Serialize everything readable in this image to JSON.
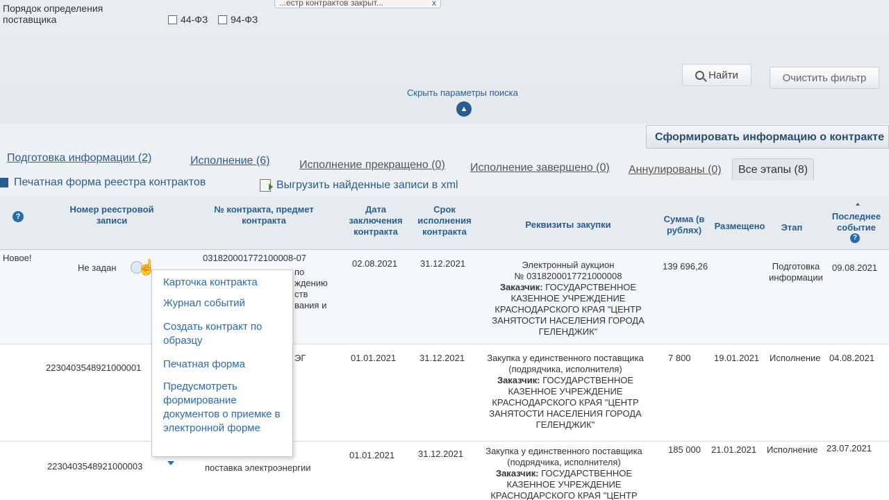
{
  "browser_tab": {
    "title": "...естр контрактов закрыт...",
    "close": "x"
  },
  "search": {
    "order_label": "Порядок определения поставщика",
    "law_options": [
      "44-ФЗ",
      "94-ФЗ"
    ],
    "find_button": "Найти",
    "clear_button": "Очистить фильтр",
    "hide_params": "Скрыть параметры поиска"
  },
  "generate_button": "Сформировать информацию о контракте",
  "tabs": [
    {
      "label": "Подготовка информации (2)"
    },
    {
      "label": "Исполнение (6)"
    },
    {
      "label": "Исполнение прекращено (0)"
    },
    {
      "label": "Исполнение завершено (0)"
    },
    {
      "label": "Аннулированы (0)"
    },
    {
      "label": "Все этапы (8)"
    }
  ],
  "toolbar": {
    "print_registry": "Печатная форма реестра контрактов",
    "export_xml": "Выгрузить найденные записи в xml"
  },
  "table": {
    "headers": {
      "registry_number": "Номер реестровой записи",
      "contract_number": "№ контракта, предмет контракта",
      "conclusion_date": "Дата заключения контракта",
      "execution_term": "Срок исполнения контракта",
      "procurement_details": "Реквизиты закупки",
      "amount": "Сумма (в рублях)",
      "placed": "Размещено",
      "stage": "Этап",
      "last_event": "Последнее событие"
    },
    "rows": [
      {
        "flag": "Новое!",
        "registry_number": "Не задан",
        "contract_number": "031820001772100008-07",
        "subject_fragments": [
          "по",
          "ждению",
          "ств",
          "вания и"
        ],
        "conclusion_date": "02.08.2021",
        "execution_term": "31.12.2021",
        "procurement_type": "Электронный аукцион",
        "procurement_number": "№ 0318200017721000008",
        "customer_label": "Заказчик:",
        "customer_name": "ГОСУДАРСТВЕННОЕ КАЗЕННОЕ УЧРЕЖДЕНИЕ КРАСНОДАРСКОГО КРАЯ \"ЦЕНТР ЗАНЯТОСТИ НАСЕЛЕНИЯ ГОРОДА ГЕЛЕНДЖИК\"",
        "amount": "139 696,26",
        "placed": "",
        "stage": "Подготовка информации",
        "last_event": "09.08.2021"
      },
      {
        "flag": "",
        "registry_number": "2230403548921000001",
        "subject_fragment": "ЭГ",
        "conclusion_date": "01.01.2021",
        "execution_term": "31.12.2021",
        "procurement_type": "Закупка у единственного поставщика (подрядчика, исполнителя)",
        "customer_label": "Заказчик:",
        "customer_name": "ГОСУДАРСТВЕННОЕ КАЗЕННОЕ УЧРЕЖДЕНИЕ КРАСНОДАРСКОГО КРАЯ \"ЦЕНТР ЗАНЯТОСТИ НАСЕЛЕНИЯ ГОРОДА ГЕЛЕНДЖИК\"",
        "amount": "7 800",
        "placed": "19.01.2021",
        "stage": "Исполнение",
        "last_event": "04.08.2021"
      },
      {
        "flag": "",
        "registry_number": "2230403548921000003",
        "subject": "поставка электроэнергии",
        "conclusion_date": "01.01.2021",
        "execution_term": "31.12.2021",
        "procurement_type": "Закупка у единственного поставщика (подрядчика, исполнителя)",
        "customer_label": "Заказчик:",
        "customer_name": "ГОСУДАРСТВЕННОЕ КАЗЕННОЕ УЧРЕЖДЕНИЕ КРАСНОДАРСКОГО КРАЯ \"ЦЕНТР",
        "amount": "185 000",
        "placed": "21.01.2021",
        "stage": "Исполнение",
        "last_event": "23.07.2021"
      }
    ]
  },
  "context_menu": {
    "items": [
      "Карточка контракта",
      "Журнал событий",
      "Создать контракт по образцу",
      "Печатная форма",
      "Предусмотреть формирование документов о приемке в электронной форме"
    ]
  },
  "icons": {
    "help": "?",
    "hide_arrow": "▲",
    "pointer": "☝"
  },
  "colors": {
    "link": "#2a5d8f",
    "accent": "#2a6bb0"
  }
}
